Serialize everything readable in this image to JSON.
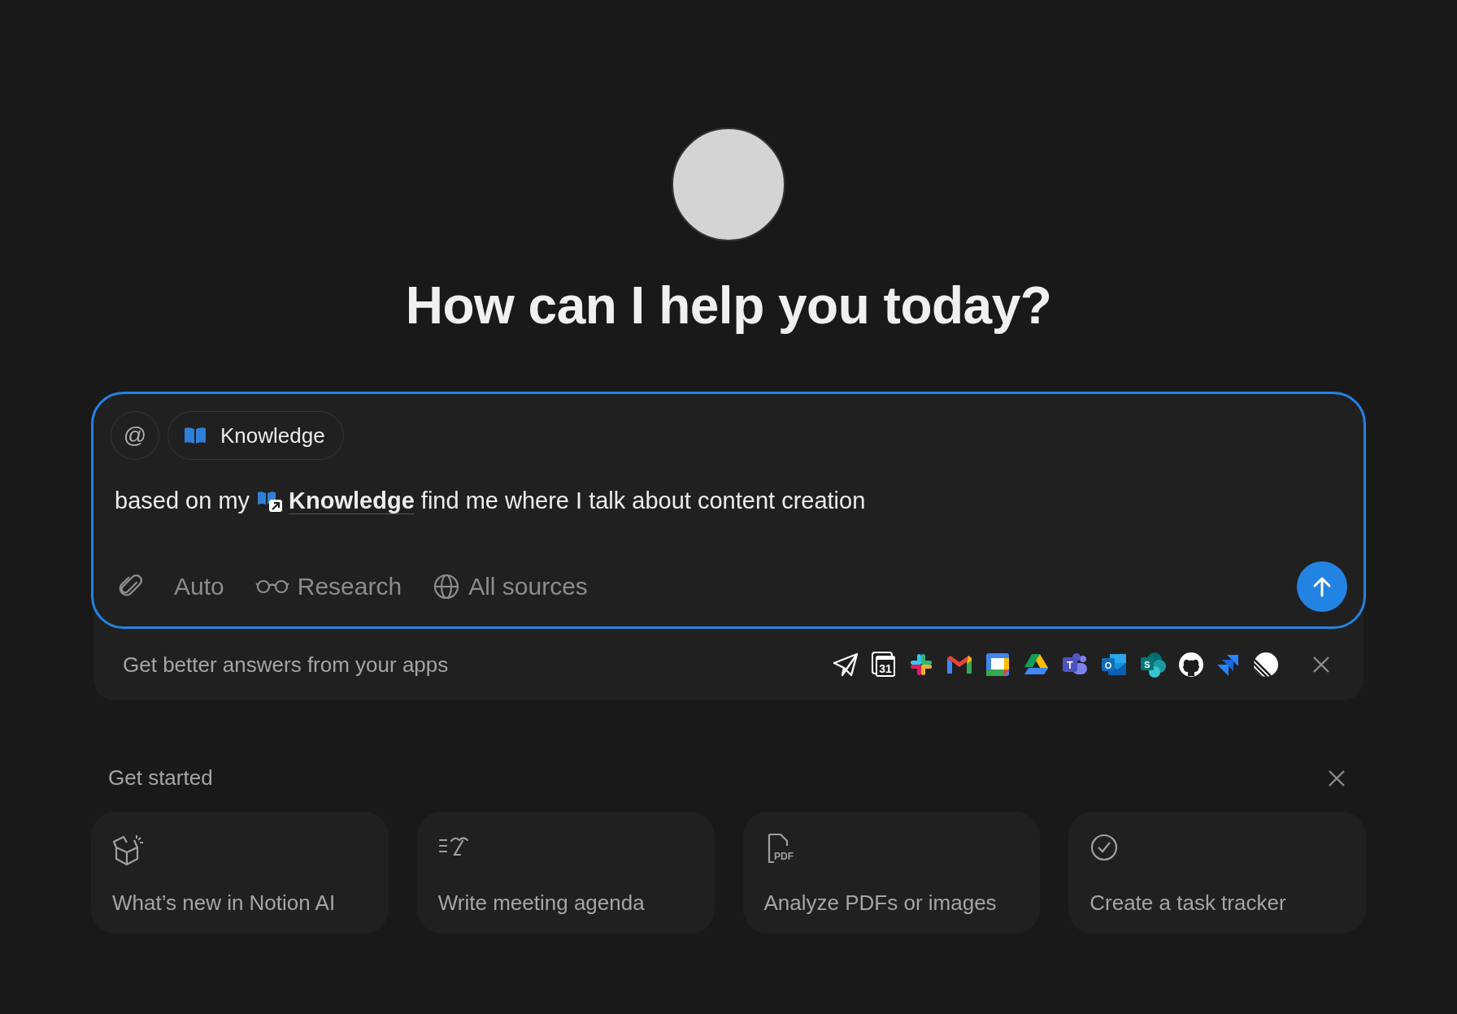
{
  "heading": "How can I help you today?",
  "composer": {
    "mention_button": "@",
    "context_chip": {
      "label": "Knowledge"
    },
    "prompt": [
      {
        "kind": "text",
        "text": "based on my "
      },
      {
        "kind": "mention",
        "text": "Knowledge"
      },
      {
        "kind": "text",
        "text": " find me where I talk about content creation"
      }
    ],
    "tools": [
      {
        "kind": "attach"
      },
      {
        "kind": "model",
        "label": "Auto"
      },
      {
        "kind": "research",
        "label": "Research"
      },
      {
        "kind": "sources",
        "label": "All sources"
      }
    ],
    "focused": true
  },
  "apps_banner": {
    "text": "Get better answers from your apps",
    "apps": [
      {
        "kind": "plane"
      },
      {
        "kind": "calendar",
        "label": "31"
      },
      {
        "kind": "slack"
      },
      {
        "kind": "mail"
      },
      {
        "kind": "square"
      },
      {
        "kind": "drive"
      },
      {
        "kind": "teams",
        "label": "T"
      },
      {
        "kind": "outlook",
        "label": "O"
      },
      {
        "kind": "sharepoint",
        "label": "S"
      },
      {
        "kind": "github"
      },
      {
        "kind": "jira"
      },
      {
        "kind": "linear"
      }
    ]
  },
  "get_started": {
    "title": "Get started",
    "cards": [
      {
        "kind": "box",
        "label": "What’s new in Notion AI"
      },
      {
        "kind": "agenda",
        "label": "Write meeting agenda"
      },
      {
        "kind": "pdf",
        "icon_label": "PDF",
        "label": "Analyze PDFs or images"
      },
      {
        "kind": "check",
        "label": "Create a task tracker"
      }
    ]
  }
}
